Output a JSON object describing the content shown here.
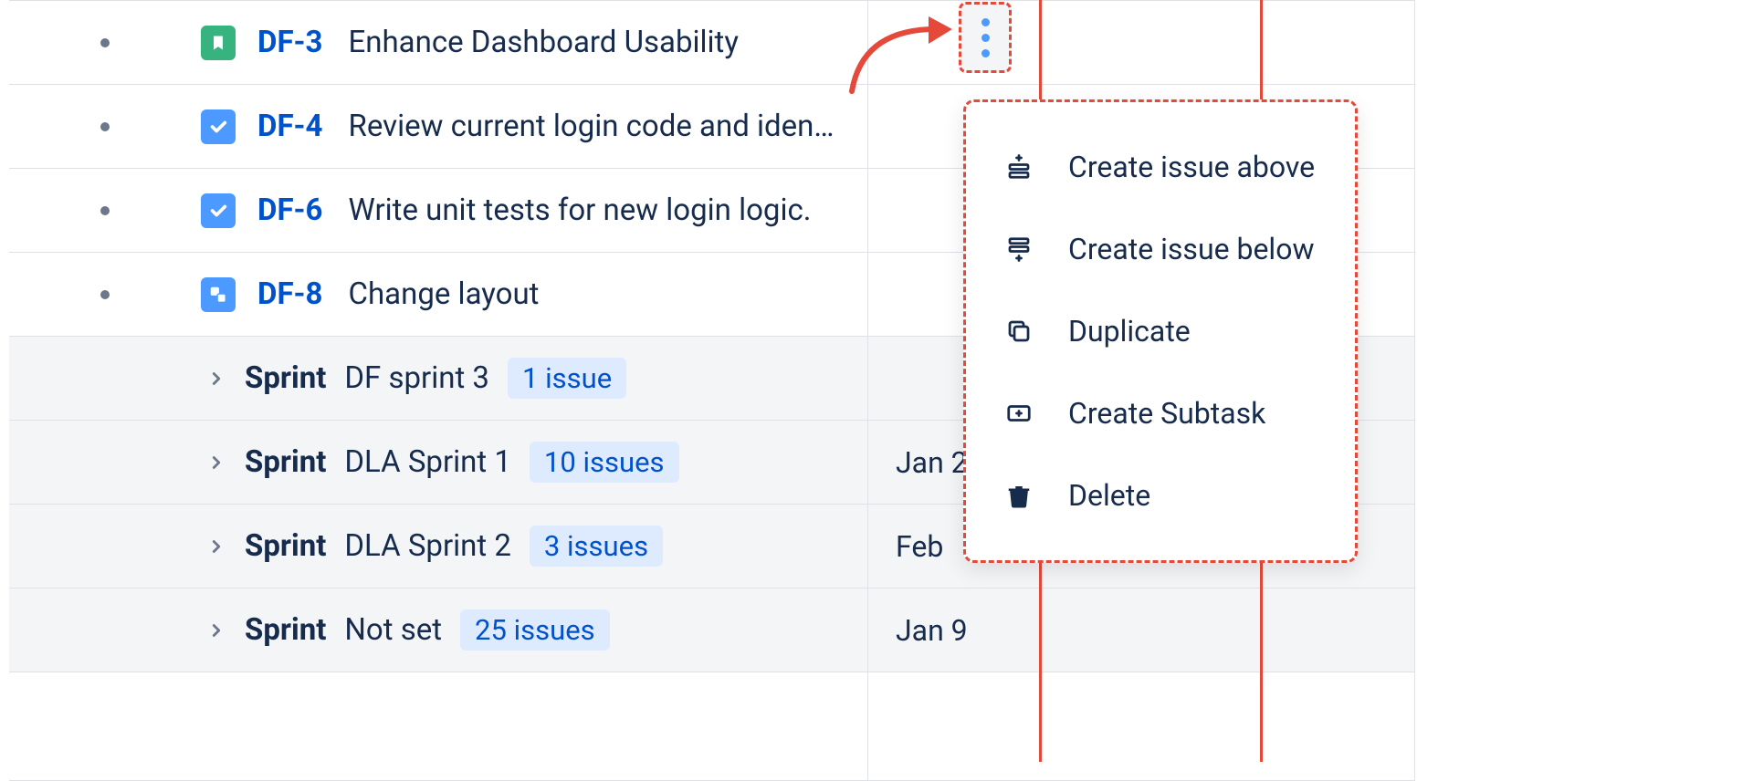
{
  "issues": [
    {
      "key": "DF-3",
      "title": "Enhance Dashboard Usability",
      "type": "story"
    },
    {
      "key": "DF-4",
      "title": "Review current login code and iden…",
      "type": "task"
    },
    {
      "key": "DF-6",
      "title": "Write unit tests for new login logic.",
      "type": "task"
    },
    {
      "key": "DF-8",
      "title": "Change layout",
      "type": "subtask"
    }
  ],
  "sprints": [
    {
      "label": "Sprint",
      "name": "DF sprint 3",
      "count": "1 issue",
      "date": ""
    },
    {
      "label": "Sprint",
      "name": "DLA Sprint 1",
      "count": "10 issues",
      "date": "Jan 2"
    },
    {
      "label": "Sprint",
      "name": "DLA Sprint 2",
      "count": "3 issues",
      "date": "Feb"
    },
    {
      "label": "Sprint",
      "name": "Not set",
      "count": "25 issues",
      "date": "Jan 9"
    }
  ],
  "menu": {
    "create_above": "Create issue above",
    "create_below": "Create issue below",
    "duplicate": "Duplicate",
    "create_subtask": "Create Subtask",
    "delete": "Delete"
  }
}
